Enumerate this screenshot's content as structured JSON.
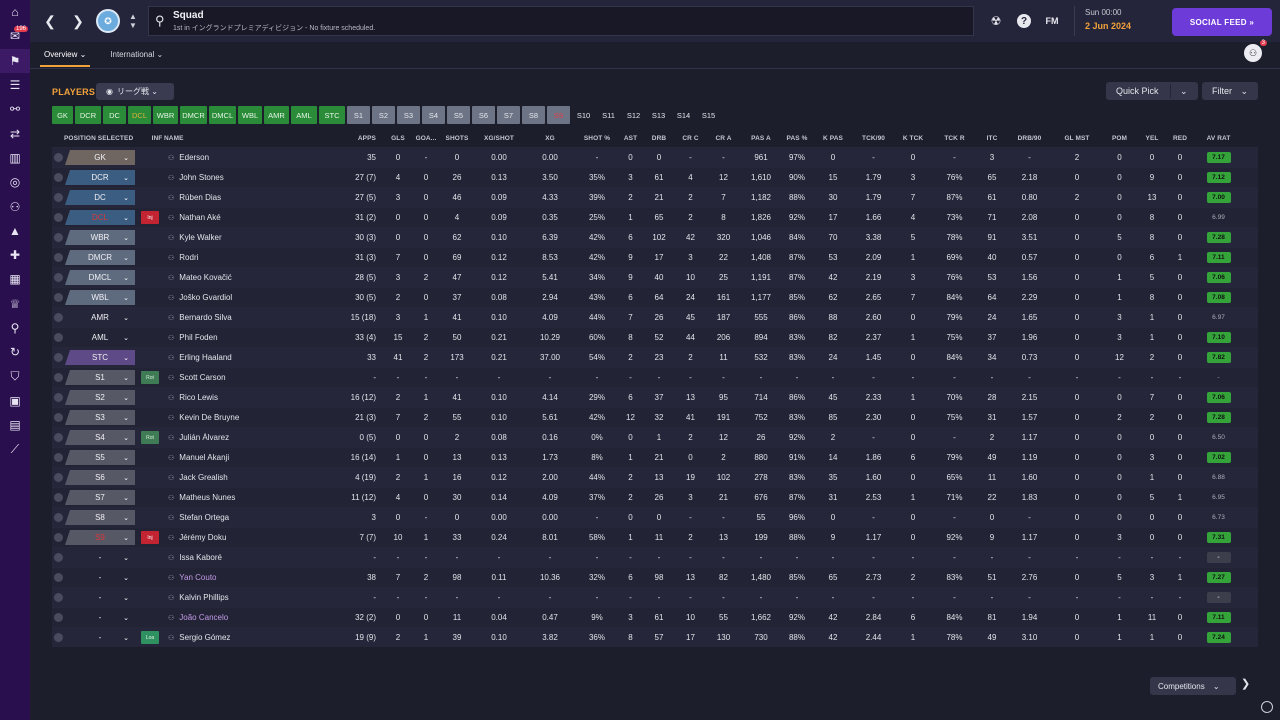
{
  "header": {
    "title": "Squad",
    "subtitle": "1st in イングランドプレミアディビジョン - No fixture scheduled.",
    "fm_label": "FM",
    "time": "Sun 00:00",
    "date": "2 Jun 2024",
    "social_label": "SOCIAL FEED",
    "staff_badge": "3"
  },
  "sidebar": {
    "items": [
      {
        "icon": "home-icon",
        "glyph": "⌂",
        "badge": ""
      },
      {
        "icon": "inbox-icon",
        "glyph": "✉",
        "badge": "196"
      },
      {
        "icon": "club-icon",
        "glyph": "⚑",
        "badge": "",
        "active": true
      },
      {
        "icon": "squad-list-icon",
        "glyph": "☰",
        "badge": ""
      },
      {
        "icon": "tactics-icon",
        "glyph": "⚯",
        "badge": ""
      },
      {
        "icon": "transfers-icon",
        "glyph": "⇄",
        "badge": ""
      },
      {
        "icon": "data-hub-icon",
        "glyph": "▥",
        "badge": ""
      },
      {
        "icon": "scouting-icon",
        "glyph": "◎",
        "badge": ""
      },
      {
        "icon": "staff-icon",
        "glyph": "⚇",
        "badge": ""
      },
      {
        "icon": "training-icon",
        "glyph": "▲",
        "badge": ""
      },
      {
        "icon": "medical-icon",
        "glyph": "✚",
        "badge": ""
      },
      {
        "icon": "schedule-icon",
        "glyph": "▦",
        "badge": ""
      },
      {
        "icon": "competitions-icon",
        "glyph": "♕",
        "badge": ""
      },
      {
        "icon": "search-icon",
        "glyph": "⚲",
        "badge": ""
      },
      {
        "icon": "dev-centre-icon",
        "glyph": "↻",
        "badge": ""
      },
      {
        "icon": "club-vision-icon",
        "glyph": "⛉",
        "badge": ""
      },
      {
        "icon": "finances-icon",
        "glyph": "▣",
        "badge": ""
      },
      {
        "icon": "board-icon",
        "glyph": "▤",
        "badge": ""
      },
      {
        "icon": "stats-icon",
        "glyph": "⟋",
        "badge": ""
      }
    ]
  },
  "tabs": [
    "Overview",
    "International"
  ],
  "toolbar": {
    "players_label": "PLAYERS",
    "view_label": "リーグ戦",
    "quick_pick": "Quick Pick",
    "filter": "Filter"
  },
  "positions": [
    {
      "label": "GK",
      "style": "g"
    },
    {
      "label": "DCR",
      "style": "g"
    },
    {
      "label": "DC",
      "style": "g"
    },
    {
      "label": "DCL",
      "style": "o"
    },
    {
      "label": "WBR",
      "style": "g"
    },
    {
      "label": "DMCR",
      "style": "g"
    },
    {
      "label": "DMCL",
      "style": "g"
    },
    {
      "label": "WBL",
      "style": "g"
    },
    {
      "label": "AMR",
      "style": "g"
    },
    {
      "label": "AML",
      "style": "g"
    },
    {
      "label": "STC",
      "style": "g"
    },
    {
      "label": "S1",
      "style": "s"
    },
    {
      "label": "S2",
      "style": "s"
    },
    {
      "label": "S3",
      "style": "s"
    },
    {
      "label": "S4",
      "style": "s"
    },
    {
      "label": "S5",
      "style": "s"
    },
    {
      "label": "S6",
      "style": "s"
    },
    {
      "label": "S7",
      "style": "s"
    },
    {
      "label": "S8",
      "style": "s"
    },
    {
      "label": "S9",
      "style": "r"
    },
    {
      "label": "S10",
      "style": "n"
    },
    {
      "label": "S11",
      "style": "n"
    },
    {
      "label": "S12",
      "style": "n"
    },
    {
      "label": "S13",
      "style": "n"
    },
    {
      "label": "S14",
      "style": "n"
    },
    {
      "label": "S15",
      "style": "n"
    }
  ],
  "table": {
    "columns": [
      "",
      "POSITION SELECTED",
      "INF",
      "NAME",
      "APPS",
      "GLS",
      "GOA...",
      "SHOTS",
      "XG/SHOT",
      "XG",
      "SHOT %",
      "AST",
      "DRB",
      "CR C",
      "CR A",
      "PAS A",
      "PAS %",
      "K PAS",
      "TCK/90",
      "K TCK",
      "TCK R",
      "ITC",
      "DRB/90",
      "GL MST",
      "POM",
      "YEL",
      "RED",
      "AV RAT"
    ],
    "rows": [
      {
        "pos": "GK",
        "pclass": "gk",
        "inf": "",
        "name": "Ederson",
        "stats": [
          "35",
          "0",
          "-",
          "0",
          "0.00",
          "0.00",
          "-",
          "0",
          "0",
          "-",
          "-",
          "961",
          "97%",
          "0",
          "-",
          "0",
          "-",
          "3",
          "-",
          "2",
          "0",
          "0",
          "0"
        ],
        "rating": "7.17",
        "rc": "g"
      },
      {
        "pos": "DCR",
        "pclass": "def",
        "inf": "",
        "name": "John Stones",
        "stats": [
          "27 (7)",
          "4",
          "0",
          "26",
          "0.13",
          "3.50",
          "35%",
          "3",
          "61",
          "4",
          "12",
          "1,610",
          "90%",
          "15",
          "1.79",
          "3",
          "76%",
          "65",
          "2.18",
          "0",
          "0",
          "9",
          "0"
        ],
        "rating": "7.12",
        "rc": "g"
      },
      {
        "pos": "DC",
        "pclass": "def",
        "inf": "",
        "name": "Rúben Dias",
        "stats": [
          "27 (5)",
          "3",
          "0",
          "46",
          "0.09",
          "4.33",
          "39%",
          "2",
          "21",
          "2",
          "7",
          "1,182",
          "88%",
          "30",
          "1.79",
          "7",
          "87%",
          "61",
          "0.80",
          "2",
          "0",
          "13",
          "0"
        ],
        "rating": "7.00",
        "rc": "g"
      },
      {
        "pos": "DCL",
        "pclass": "def",
        "red": true,
        "inf": "Inj",
        "it": "inj",
        "name": "Nathan Aké",
        "stats": [
          "31 (2)",
          "0",
          "0",
          "4",
          "0.09",
          "0.35",
          "25%",
          "1",
          "65",
          "2",
          "8",
          "1,826",
          "92%",
          "17",
          "1.66",
          "4",
          "73%",
          "71",
          "2.08",
          "0",
          "0",
          "8",
          "0"
        ],
        "rating": "6.99",
        "rc": "n"
      },
      {
        "pos": "WBR",
        "pclass": "mid",
        "inf": "",
        "name": "Kyle Walker",
        "stats": [
          "30 (3)",
          "0",
          "0",
          "62",
          "0.10",
          "6.39",
          "42%",
          "6",
          "102",
          "42",
          "320",
          "1,046",
          "84%",
          "70",
          "3.38",
          "5",
          "78%",
          "91",
          "3.51",
          "0",
          "5",
          "8",
          "0"
        ],
        "rating": "7.28",
        "rc": "g"
      },
      {
        "pos": "DMCR",
        "pclass": "mid",
        "inf": "",
        "name": "Rodri",
        "stats": [
          "31 (3)",
          "7",
          "0",
          "69",
          "0.12",
          "8.53",
          "42%",
          "9",
          "17",
          "3",
          "22",
          "1,408",
          "87%",
          "53",
          "2.09",
          "1",
          "69%",
          "40",
          "0.57",
          "0",
          "0",
          "6",
          "1"
        ],
        "rating": "7.11",
        "rc": "g"
      },
      {
        "pos": "DMCL",
        "pclass": "mid",
        "inf": "",
        "name": "Mateo Kovačić",
        "stats": [
          "28 (5)",
          "3",
          "2",
          "47",
          "0.12",
          "5.41",
          "34%",
          "9",
          "40",
          "10",
          "25",
          "1,191",
          "87%",
          "42",
          "2.19",
          "3",
          "76%",
          "53",
          "1.56",
          "0",
          "1",
          "5",
          "0"
        ],
        "rating": "7.06",
        "rc": "g"
      },
      {
        "pos": "WBL",
        "pclass": "mid",
        "inf": "",
        "name": "Joško Gvardiol",
        "stats": [
          "30 (5)",
          "2",
          "0",
          "37",
          "0.08",
          "2.94",
          "43%",
          "6",
          "64",
          "24",
          "161",
          "1,177",
          "85%",
          "62",
          "2.65",
          "7",
          "84%",
          "64",
          "2.29",
          "0",
          "1",
          "8",
          "0"
        ],
        "rating": "7.08",
        "rc": "g"
      },
      {
        "pos": "AMR",
        "pclass": "none",
        "inf": "",
        "name": "Bernardo Silva",
        "stats": [
          "15 (18)",
          "3",
          "1",
          "41",
          "0.10",
          "4.09",
          "44%",
          "7",
          "26",
          "45",
          "187",
          "555",
          "86%",
          "88",
          "2.60",
          "0",
          "79%",
          "24",
          "1.65",
          "0",
          "3",
          "1",
          "0"
        ],
        "rating": "6.97",
        "rc": "n"
      },
      {
        "pos": "AML",
        "pclass": "none",
        "inf": "",
        "name": "Phil Foden",
        "stats": [
          "33 (4)",
          "15",
          "2",
          "50",
          "0.21",
          "10.29",
          "60%",
          "8",
          "52",
          "44",
          "206",
          "894",
          "83%",
          "82",
          "2.37",
          "1",
          "75%",
          "37",
          "1.96",
          "0",
          "3",
          "1",
          "0"
        ],
        "rating": "7.10",
        "rc": "g"
      },
      {
        "pos": "STC",
        "pclass": "att",
        "inf": "",
        "name": "Erling Haaland",
        "stats": [
          "33",
          "41",
          "2",
          "173",
          "0.21",
          "37.00",
          "54%",
          "2",
          "23",
          "2",
          "11",
          "532",
          "83%",
          "24",
          "1.45",
          "0",
          "84%",
          "34",
          "0.73",
          "0",
          "12",
          "2",
          "0"
        ],
        "rating": "7.82",
        "rc": "g"
      },
      {
        "pos": "S1",
        "pclass": "sub",
        "inf": "Rot",
        "it": "rot",
        "name": "Scott Carson",
        "stats": [
          "-",
          "-",
          "-",
          "-",
          "-",
          "-",
          "-",
          "-",
          "-",
          "-",
          "-",
          "-",
          "-",
          "-",
          "-",
          "-",
          "-",
          "-",
          "-",
          "-",
          "-",
          "-",
          "-"
        ],
        "rating": "-",
        "rc": "n"
      },
      {
        "pos": "S2",
        "pclass": "sub",
        "inf": "",
        "name": "Rico Lewis",
        "stats": [
          "16 (12)",
          "2",
          "1",
          "41",
          "0.10",
          "4.14",
          "29%",
          "6",
          "37",
          "13",
          "95",
          "714",
          "86%",
          "45",
          "2.33",
          "1",
          "70%",
          "28",
          "2.15",
          "0",
          "0",
          "7",
          "0"
        ],
        "rating": "7.06",
        "rc": "g"
      },
      {
        "pos": "S3",
        "pclass": "sub",
        "inf": "",
        "name": "Kevin De Bruyne",
        "stats": [
          "21 (3)",
          "7",
          "2",
          "55",
          "0.10",
          "5.61",
          "42%",
          "12",
          "32",
          "41",
          "191",
          "752",
          "83%",
          "85",
          "2.30",
          "0",
          "75%",
          "31",
          "1.57",
          "0",
          "2",
          "2",
          "0"
        ],
        "rating": "7.28",
        "rc": "g"
      },
      {
        "pos": "S4",
        "pclass": "sub",
        "inf": "Rot",
        "it": "rot",
        "name": "Julián Álvarez",
        "stats": [
          "0 (5)",
          "0",
          "0",
          "2",
          "0.08",
          "0.16",
          "0%",
          "0",
          "1",
          "2",
          "12",
          "26",
          "92%",
          "2",
          "-",
          "0",
          "-",
          "2",
          "1.17",
          "0",
          "0",
          "0",
          "0"
        ],
        "rating": "6.50",
        "rc": "n"
      },
      {
        "pos": "S5",
        "pclass": "sub",
        "inf": "",
        "name": "Manuel Akanji",
        "stats": [
          "16 (14)",
          "1",
          "0",
          "13",
          "0.13",
          "1.73",
          "8%",
          "1",
          "21",
          "0",
          "2",
          "880",
          "91%",
          "14",
          "1.86",
          "6",
          "79%",
          "49",
          "1.19",
          "0",
          "0",
          "3",
          "0"
        ],
        "rating": "7.02",
        "rc": "g"
      },
      {
        "pos": "S6",
        "pclass": "sub",
        "inf": "",
        "name": "Jack Grealish",
        "stats": [
          "4 (19)",
          "2",
          "1",
          "16",
          "0.12",
          "2.00",
          "44%",
          "2",
          "13",
          "19",
          "102",
          "278",
          "83%",
          "35",
          "1.60",
          "0",
          "65%",
          "11",
          "1.60",
          "0",
          "0",
          "1",
          "0"
        ],
        "rating": "6.88",
        "rc": "n"
      },
      {
        "pos": "S7",
        "pclass": "sub",
        "inf": "",
        "name": "Matheus Nunes",
        "stats": [
          "11 (12)",
          "4",
          "0",
          "30",
          "0.14",
          "4.09",
          "37%",
          "2",
          "26",
          "3",
          "21",
          "676",
          "87%",
          "31",
          "2.53",
          "1",
          "71%",
          "22",
          "1.83",
          "0",
          "0",
          "5",
          "1"
        ],
        "rating": "6.95",
        "rc": "n"
      },
      {
        "pos": "S8",
        "pclass": "sub",
        "inf": "",
        "name": "Stefan Ortega",
        "stats": [
          "3",
          "0",
          "-",
          "0",
          "0.00",
          "0.00",
          "-",
          "0",
          "0",
          "-",
          "-",
          "55",
          "96%",
          "0",
          "-",
          "0",
          "-",
          "0",
          "-",
          "0",
          "0",
          "0",
          "0"
        ],
        "rating": "6.73",
        "rc": "n"
      },
      {
        "pos": "S9",
        "pclass": "sub",
        "red": true,
        "inf": "Inj",
        "it": "inj",
        "name": "Jérémy Doku",
        "stats": [
          "7 (7)",
          "10",
          "1",
          "33",
          "0.24",
          "8.01",
          "58%",
          "1",
          "11",
          "2",
          "13",
          "199",
          "88%",
          "9",
          "1.17",
          "0",
          "92%",
          "9",
          "1.17",
          "0",
          "3",
          "0",
          "0"
        ],
        "rating": "7.31",
        "rc": "g"
      },
      {
        "pos": "-",
        "pclass": "none",
        "inf": "",
        "name": "Issa Kaboré",
        "stats": [
          "-",
          "-",
          "-",
          "-",
          "-",
          "-",
          "-",
          "-",
          "-",
          "-",
          "-",
          "-",
          "-",
          "-",
          "-",
          "-",
          "-",
          "-",
          "-",
          "-",
          "-",
          "-",
          "-"
        ],
        "rating": "-",
        "rc": "d"
      },
      {
        "pos": "-",
        "pclass": "none",
        "inf": "",
        "name": "Yan Couto",
        "purple": true,
        "stats": [
          "38",
          "7",
          "2",
          "98",
          "0.11",
          "10.36",
          "32%",
          "6",
          "98",
          "13",
          "82",
          "1,480",
          "85%",
          "65",
          "2.73",
          "2",
          "83%",
          "51",
          "2.76",
          "0",
          "5",
          "3",
          "1"
        ],
        "rating": "7.27",
        "rc": "g"
      },
      {
        "pos": "-",
        "pclass": "none",
        "inf": "",
        "name": "Kalvin Phillips",
        "stats": [
          "-",
          "-",
          "-",
          "-",
          "-",
          "-",
          "-",
          "-",
          "-",
          "-",
          "-",
          "-",
          "-",
          "-",
          "-",
          "-",
          "-",
          "-",
          "-",
          "-",
          "-",
          "-",
          "-"
        ],
        "rating": "-",
        "rc": "d"
      },
      {
        "pos": "-",
        "pclass": "none",
        "inf": "",
        "name": "João Cancelo",
        "purple": true,
        "stats": [
          "32 (2)",
          "0",
          "0",
          "11",
          "0.04",
          "0.47",
          "9%",
          "3",
          "61",
          "10",
          "55",
          "1,662",
          "92%",
          "42",
          "2.84",
          "6",
          "84%",
          "81",
          "1.94",
          "0",
          "1",
          "11",
          "0"
        ],
        "rating": "7.11",
        "rc": "g"
      },
      {
        "pos": "-",
        "pclass": "none",
        "inf": "Loa",
        "it": "loan",
        "name": "Sergio Gómez",
        "stats": [
          "19 (9)",
          "2",
          "1",
          "39",
          "0.10",
          "3.82",
          "36%",
          "8",
          "57",
          "17",
          "130",
          "730",
          "88%",
          "42",
          "2.44",
          "1",
          "78%",
          "49",
          "3.10",
          "0",
          "1",
          "1",
          "0"
        ],
        "rating": "7.24",
        "rc": "g"
      }
    ]
  },
  "footer": {
    "competitions": "Competitions"
  }
}
